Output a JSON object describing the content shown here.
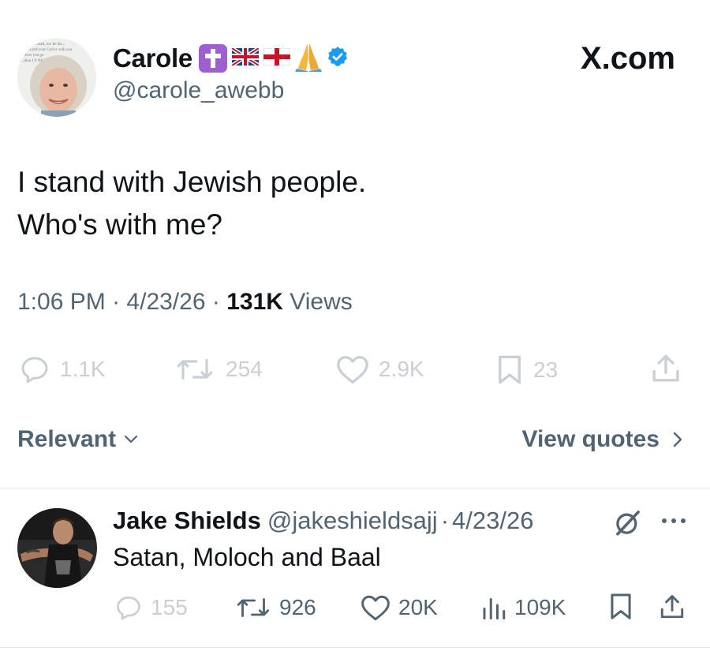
{
  "author": {
    "name": "Carole",
    "handle": "@carole_awebb",
    "avatar_caption_lines": [
      "...ssed, nor be dis...",
      "...Lord your God is with you",
      "...ever you go",
      "...shua 1:9 NKJV"
    ]
  },
  "site": {
    "wordmark": "X.com"
  },
  "tweet": {
    "lines": [
      "I stand with Jewish people.",
      "Who's with me?"
    ],
    "time": "1:06 PM",
    "sep1": "·",
    "date": "4/23/26",
    "sep2": "·",
    "views_count": "131K",
    "views_label": "Views",
    "stats": {
      "replies": "1.1K",
      "reposts": "254",
      "likes": "2.9K",
      "bookmarks": "23"
    }
  },
  "sort": {
    "label": "Relevant",
    "quotes_label": "View quotes"
  },
  "reply": {
    "name": "Jake Shields",
    "handle": "@jakeshieldsajj",
    "sep": "·",
    "date": "4/23/26",
    "text": "Satan, Moloch and Baal",
    "stats": {
      "replies": "155",
      "reposts": "926",
      "likes": "20K",
      "views": "109K"
    }
  },
  "colors": {
    "text_primary": "#0f1419",
    "text_secondary": "#536471",
    "faded": "#c9cfd4",
    "verified": "#1d9bf0",
    "cross_emoji_bg": "#a05fd0"
  },
  "icons": [
    "cross-emoji-icon",
    "uk-flag-icon",
    "england-flag-icon",
    "praying-hands-icon",
    "verified-badge-icon",
    "reply-icon",
    "repost-icon",
    "like-icon",
    "bookmark-icon",
    "share-icon",
    "chevron-down-icon",
    "chevron-right-icon",
    "grok-icon",
    "more-icon",
    "views-icon"
  ]
}
